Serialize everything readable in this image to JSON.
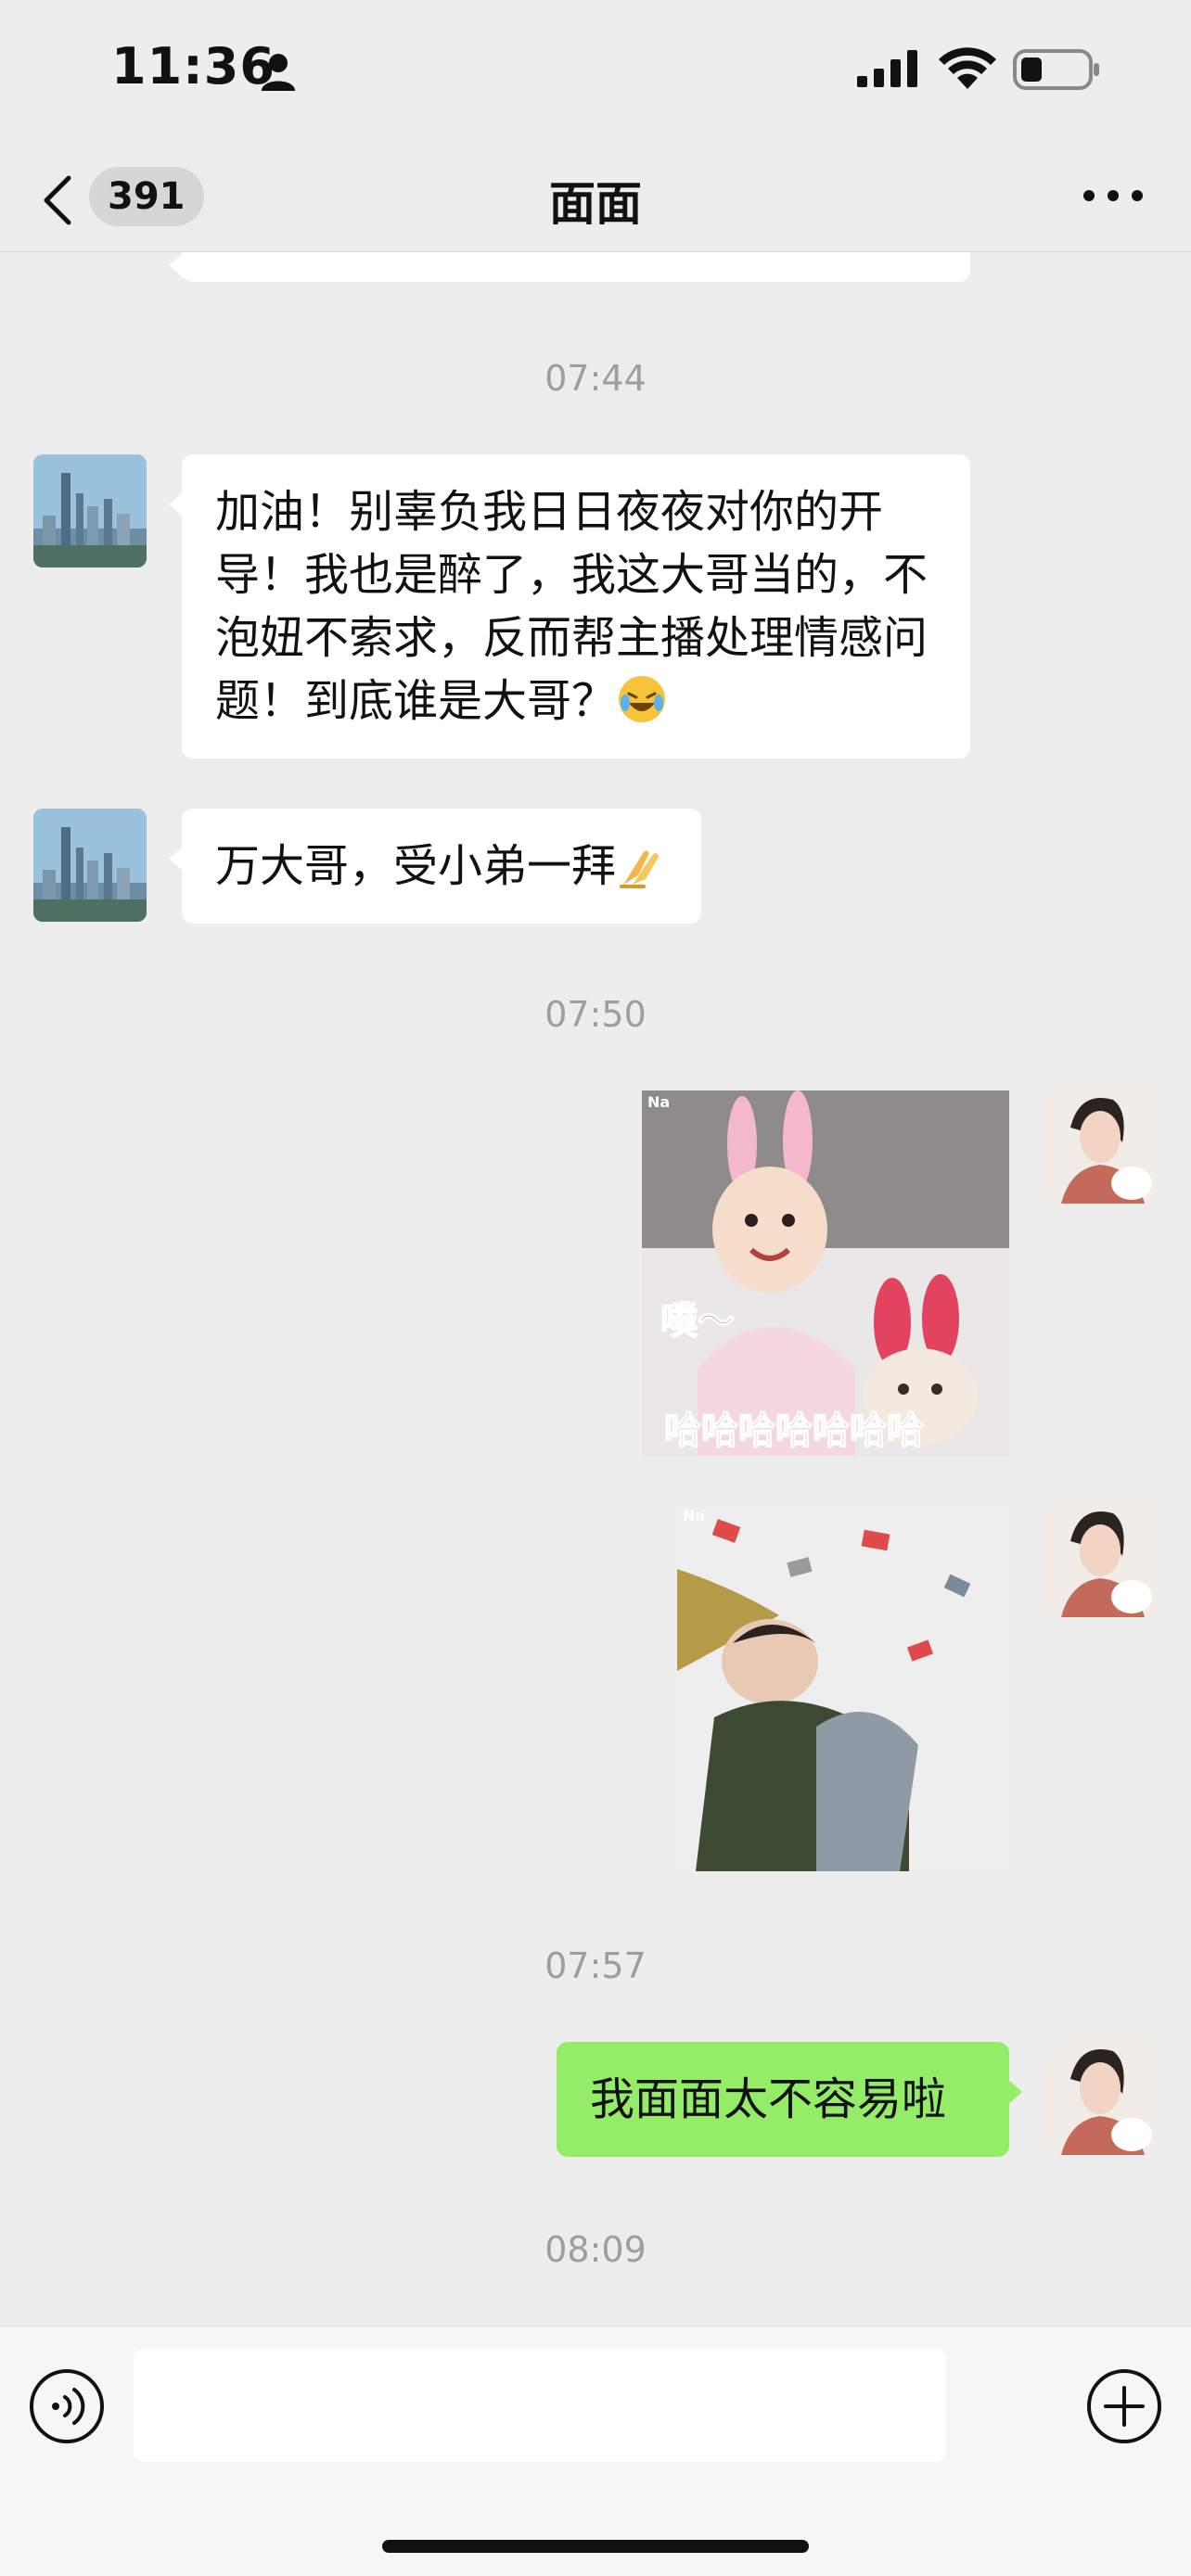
{
  "status_bar": {
    "time": "11:36",
    "icons": [
      "person-icon",
      "signal-icon",
      "wifi-icon",
      "battery-icon"
    ]
  },
  "nav": {
    "unread_count": "391",
    "title": "面面",
    "back_icon": "chevron-left-icon",
    "more_icon": "ellipsis-icon"
  },
  "messages": {
    "ts1": "07:44",
    "msg1": "加油！别辜负我日日夜夜对你的开导！我也是醉了，我这大哥当的，不泡妞不索求，反而帮主播处理情感问题！到底谁是大哥？",
    "msg1_emoji": "laughing-crying-emoji",
    "msg2": "万大哥，受小弟一拜",
    "msg2_emoji": "pray-hands-emoji",
    "ts2": "07:50",
    "sticker1": {
      "watermark": "Na",
      "side_text": "噗～",
      "caption": "哈哈哈哈哈哈哈"
    },
    "sticker2": {
      "watermark": "Na"
    },
    "ts3": "07:57",
    "msg3": "我面面太不容易啦",
    "ts4": "08:09"
  },
  "input_bar": {
    "voice_icon": "voice-icon",
    "plus_icon": "plus-circle-icon",
    "placeholder": ""
  },
  "colors": {
    "background": "#ededed",
    "incoming_bubble": "#ffffff",
    "outgoing_bubble": "#95ec69",
    "timestamp": "#9e9e9e"
  }
}
